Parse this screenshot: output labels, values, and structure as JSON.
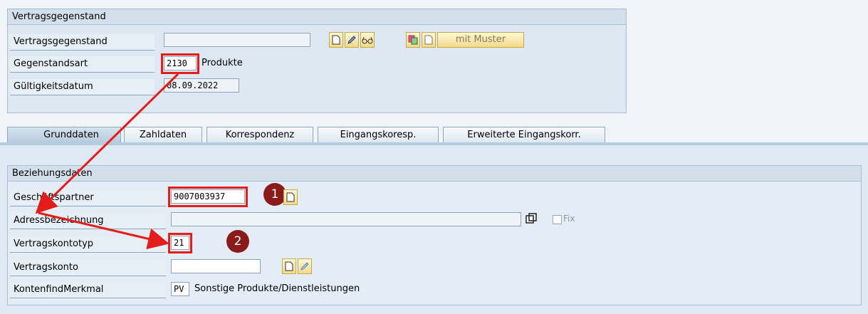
{
  "header_group": {
    "title": "Vertragsgegenstand",
    "fields": {
      "vertragsgegenstand": {
        "label": "Vertragsgegenstand",
        "value": ""
      },
      "gegenstandsart": {
        "label": "Gegenstandsart",
        "value": "2130",
        "description": "Produkte"
      },
      "gueltigkeitsdatum": {
        "label": "Gültigkeitsdatum",
        "value": "08.09.2022"
      }
    },
    "buttons": {
      "mit_muster": "mit Muster"
    }
  },
  "tabs": [
    {
      "label": "Grunddaten",
      "active": true
    },
    {
      "label": "Zahldaten"
    },
    {
      "label": "Korrespondenz"
    },
    {
      "label": "Eingangskoresp."
    },
    {
      "label": "Erweiterte Eingangskorr."
    }
  ],
  "relationship_group": {
    "title": "Beziehungsdaten",
    "fields": {
      "geschaeftspartner": {
        "label": "Geschäftspartner",
        "value": "9007003937"
      },
      "adressbezeichnung": {
        "label": "Adressbezeichnung",
        "value": "",
        "fix_label": "Fix"
      },
      "vertragskontotyp": {
        "label": "Vertragskontotyp",
        "value": "21"
      },
      "vertragskonto": {
        "label": "Vertragskonto",
        "value": ""
      },
      "kontenfindmerkmal": {
        "label": "KontenfindMerkmal",
        "value": "PV",
        "description": "Sonstige Produkte/Dienstleistungen"
      }
    }
  },
  "annotations": {
    "badge_1": "1",
    "badge_2": "2"
  },
  "colors": {
    "highlight": "#e41c1c",
    "badge": "#8b1a1a",
    "arrow": "#e41c1c"
  }
}
